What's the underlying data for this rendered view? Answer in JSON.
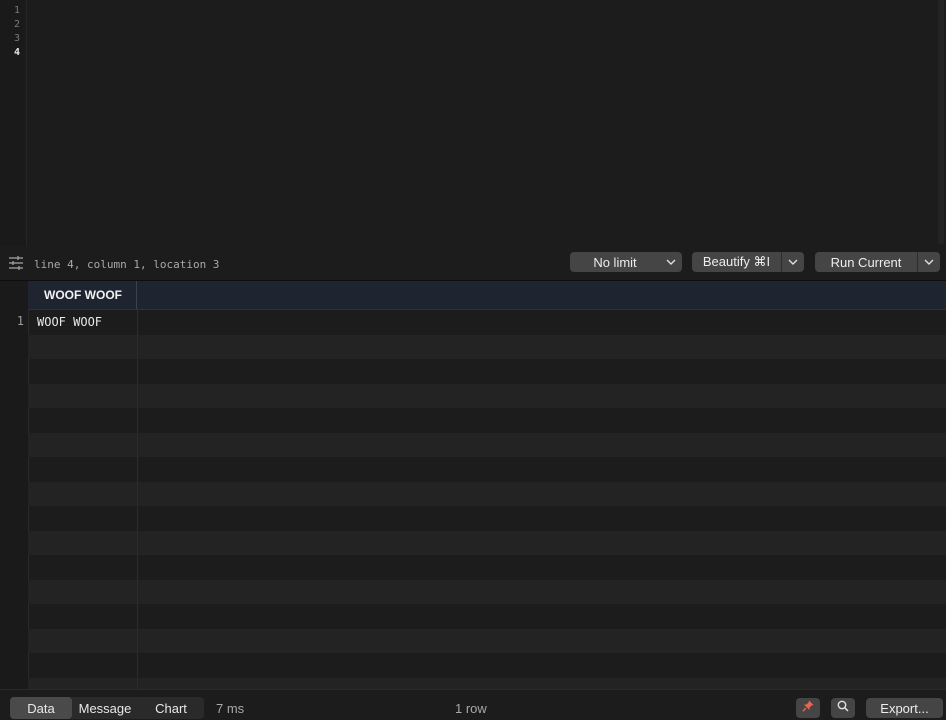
{
  "editor": {
    "line_numbers": [
      "1",
      "2",
      "3",
      "4"
    ],
    "active_line": "4",
    "content": ""
  },
  "toolbar": {
    "settings_icon": "sliders-icon",
    "cursor_status": "line 4, column 1, location 3",
    "limit_label": "No limit",
    "beautify_label": "Beautify ⌘I",
    "run_label": "Run Current"
  },
  "results": {
    "columns": [
      "WOOF WOOF"
    ],
    "rows": [
      {
        "index": "1",
        "cells": [
          "WOOF WOOF"
        ]
      }
    ]
  },
  "footer": {
    "tabs": [
      "Data",
      "Message",
      "Chart"
    ],
    "active_tab": "Data",
    "elapsed": "7 ms",
    "row_count": "1 row",
    "pin_icon": "pin-icon",
    "search_icon": "search-icon",
    "export_label": "Export..."
  },
  "colors": {
    "background": "#1c1c1c",
    "button": "#454545",
    "header_bg": "#1f2530",
    "pin_accent": "#e8654f"
  }
}
